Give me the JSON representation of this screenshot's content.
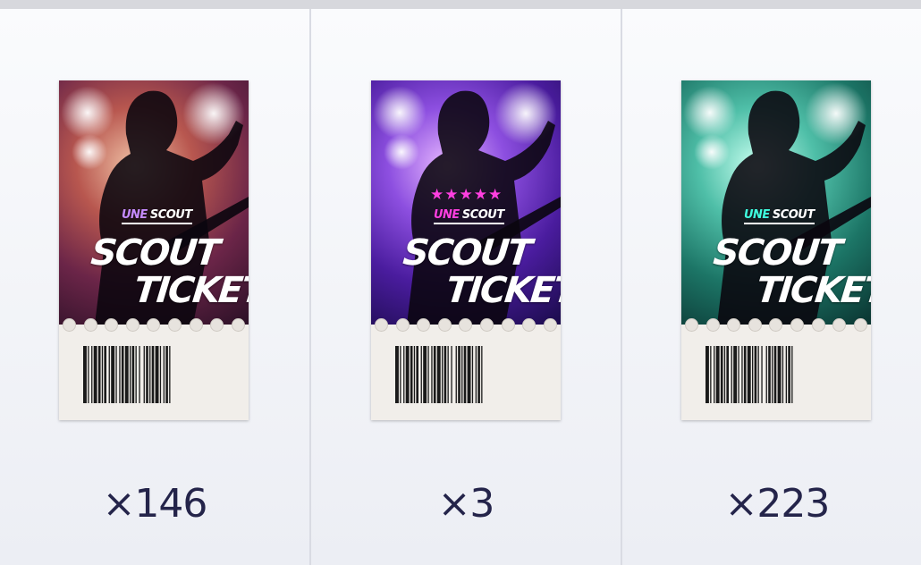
{
  "tickets": [
    {
      "logo": {
        "brand": "UNE",
        "word": "SCOUT"
      },
      "title_line1": "SCOUT",
      "title_line2": "TICKET",
      "stars": "",
      "theme": "red",
      "accent": "#c58bff",
      "count": "×146"
    },
    {
      "logo": {
        "brand": "UNE",
        "word": "SCOUT"
      },
      "title_line1": "SCOUT",
      "title_line2": "TICKET",
      "stars": "★★★★★",
      "theme": "purple",
      "accent": "#ff3fe0",
      "count": "×3"
    },
    {
      "logo": {
        "brand": "UNE",
        "word": "SCOUT"
      },
      "title_line1": "SCOUT",
      "title_line2": "TICKET",
      "stars": "",
      "theme": "teal",
      "accent": "#3fffe0",
      "count": "×223"
    }
  ],
  "colors": {
    "topbar": "#d7d8dd",
    "count_text": "#24244a"
  }
}
